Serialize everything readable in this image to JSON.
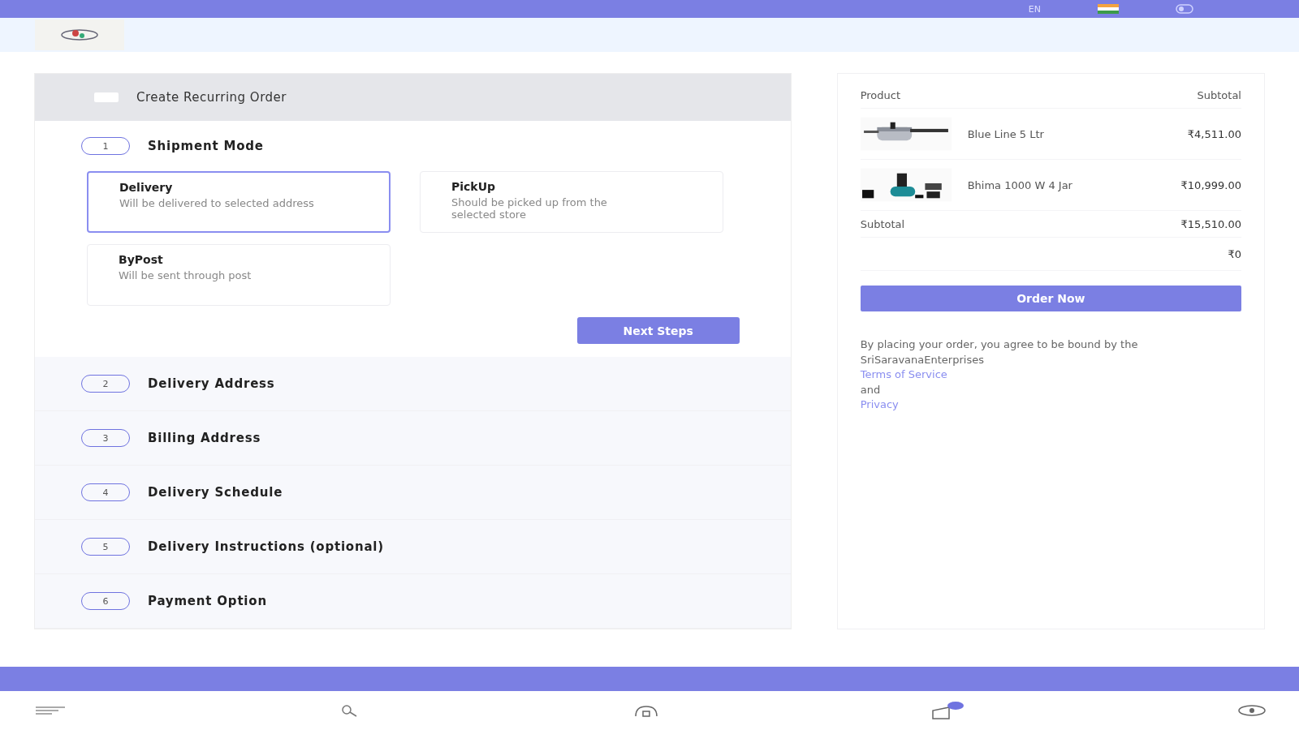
{
  "top_bar": {
    "language": "EN"
  },
  "recurring_order": {
    "label": "Create Recurring Order",
    "checked": false
  },
  "steps": [
    {
      "number": "1",
      "title": "Shipment Mode",
      "expanded": true
    },
    {
      "number": "2",
      "title": "Delivery Address",
      "expanded": false
    },
    {
      "number": "3",
      "title": "Billing Address",
      "expanded": false
    },
    {
      "number": "4",
      "title": "Delivery Schedule",
      "expanded": false
    },
    {
      "number": "5",
      "title": "Delivery Instructions (optional)",
      "expanded": false
    },
    {
      "number": "6",
      "title": "Payment Option",
      "expanded": false
    }
  ],
  "shipment_options": [
    {
      "title": "Delivery",
      "description": "Will be delivered to selected address",
      "selected": true
    },
    {
      "title": "PickUp",
      "description": "Should be picked up from the selected store",
      "selected": false
    },
    {
      "title": "ByPost",
      "description": "Will be sent through post",
      "selected": false
    }
  ],
  "next_button": "Next Steps",
  "summary": {
    "columns": [
      "Product",
      "Subtotal"
    ],
    "items": [
      {
        "name": "Blue Line 5 Ltr",
        "price": "₹4,511.00",
        "kind": "cooker"
      },
      {
        "name": "Bhima 1000 W 4 Jar",
        "price": "₹10,999.00",
        "kind": "mixer"
      }
    ],
    "subtotal_label": "Subtotal",
    "subtotal": "₹15,510.00",
    "extra": "₹0",
    "order_button": "Order Now",
    "terms_text": "By placing your order, you agree to be bound by the SriSaravanaEnterprises",
    "terms_link": "Terms of Service",
    "and_text": "and",
    "privacy_link": "Privacy"
  }
}
